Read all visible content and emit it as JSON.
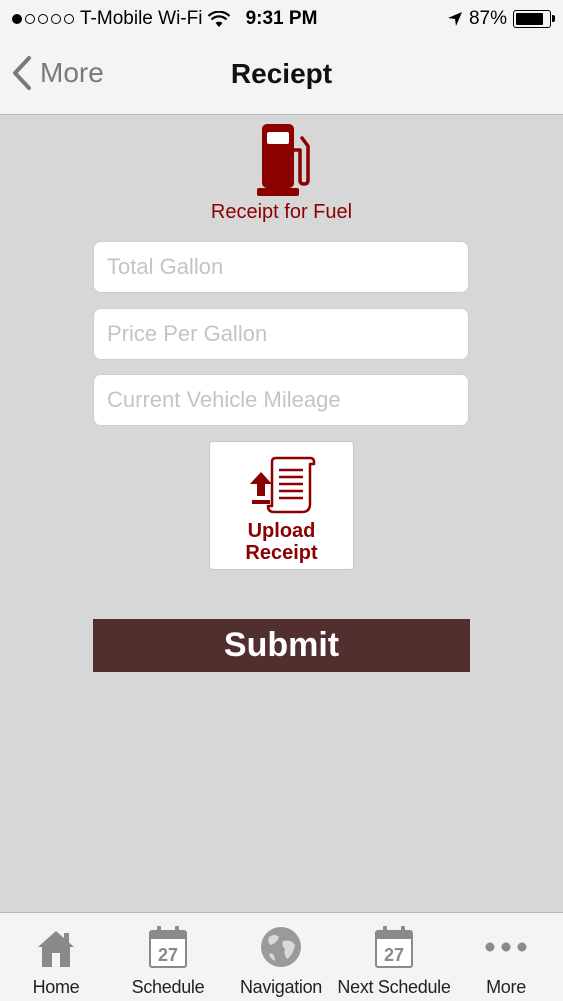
{
  "status_bar": {
    "carrier": "T-Mobile Wi-Fi",
    "time": "9:31 PM",
    "battery": "87%",
    "battery_level": 0.87
  },
  "nav": {
    "back_label": "More",
    "title": "Reciept"
  },
  "fuel": {
    "label": "Receipt for Fuel",
    "icon": "fuel-pump-icon",
    "accent_color": "#8b0000"
  },
  "form": {
    "total_gallon_placeholder": "Total Gallon",
    "price_per_gallon_placeholder": "Price Per Gallon",
    "mileage_placeholder": "Current Vehicle Mileage",
    "upload_line1": "Upload",
    "upload_line2": "Receipt",
    "submit_label": "Submit",
    "submit_color": "#512f2f"
  },
  "tab_bar": {
    "items": [
      {
        "label": "Home",
        "icon": "home-icon"
      },
      {
        "label": "Schedule",
        "icon": "calendar-icon",
        "badge": "27"
      },
      {
        "label": "Navigation",
        "icon": "globe-icon"
      },
      {
        "label": "Next Schedule",
        "icon": "calendar-icon",
        "badge": "27"
      },
      {
        "label": "More",
        "icon": "more-dots-icon"
      }
    ]
  }
}
